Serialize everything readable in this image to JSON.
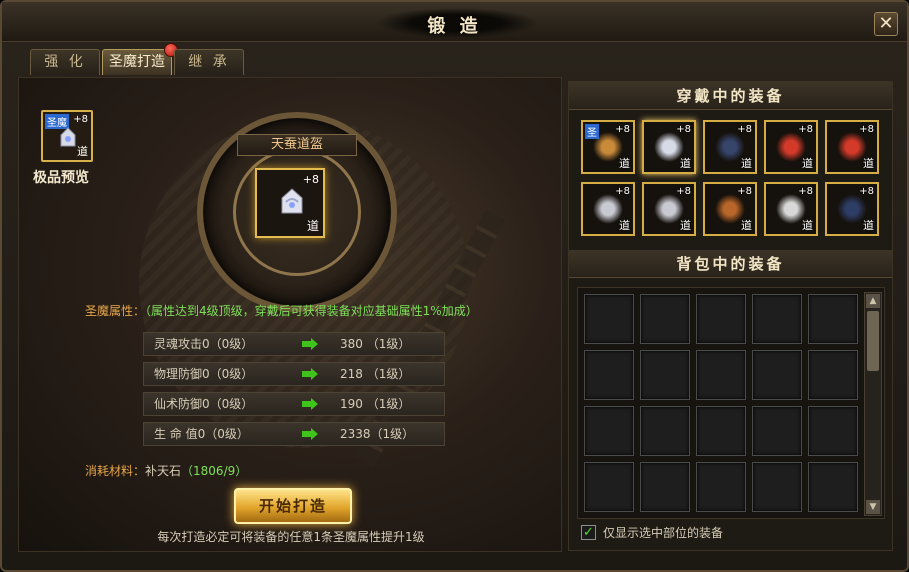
{
  "window": {
    "title": "锻 造",
    "close_glyph": "✕"
  },
  "tabs": [
    {
      "label": "强 化",
      "active": false
    },
    {
      "label": "圣魔打造",
      "active": true,
      "has_alert": true
    },
    {
      "label": "继 承",
      "active": false
    }
  ],
  "preview": {
    "tag": "圣魔",
    "plus": "+8",
    "dao": "道",
    "label": "极品预览"
  },
  "forge_item": {
    "name": "天蚕道盔",
    "plus": "+8",
    "dao": "道"
  },
  "attributes": {
    "title_label": "圣魔属性：",
    "title_note": "（属性达到4级顶级，穿戴后可获得装备对应基础属性1%加成）",
    "rows": [
      {
        "name": "灵魂攻击0（0级）",
        "value": "380 （1级）"
      },
      {
        "name": "物理防御0（0级）",
        "value": "218 （1级）"
      },
      {
        "name": "仙术防御0（0级）",
        "value": "190 （1级）"
      },
      {
        "name": "生 命 值0（0级）",
        "value": "2338（1级）"
      }
    ]
  },
  "cost": {
    "label": "消耗材料：",
    "item": "补天石",
    "amount": "（1806/9）"
  },
  "forge_button": {
    "label": "开始打造"
  },
  "forge_hint": "每次打造必定可将装备的任意1条圣魔属性提升1级",
  "equipped": {
    "title": "穿戴中的装备",
    "items": [
      {
        "icon": "bow-weapon-icon",
        "plus": "+8",
        "dao": "道",
        "tag": "圣",
        "selected": false
      },
      {
        "icon": "helmet-icon",
        "plus": "+8",
        "dao": "道",
        "tag": "",
        "selected": true
      },
      {
        "icon": "robe-armor-icon",
        "plus": "+8",
        "dao": "道",
        "tag": "",
        "selected": false
      },
      {
        "icon": "ring-icon",
        "plus": "+8",
        "dao": "道",
        "tag": "",
        "selected": false
      },
      {
        "icon": "ring-icon",
        "plus": "+8",
        "dao": "道",
        "tag": "",
        "selected": false
      },
      {
        "icon": "bracelet-icon",
        "plus": "+8",
        "dao": "道",
        "tag": "",
        "selected": false
      },
      {
        "icon": "bracelet-icon",
        "plus": "+8",
        "dao": "道",
        "tag": "",
        "selected": false
      },
      {
        "icon": "necklace-icon",
        "plus": "+8",
        "dao": "道",
        "tag": "",
        "selected": false
      },
      {
        "icon": "belt-icon",
        "plus": "+8",
        "dao": "道",
        "tag": "",
        "selected": false
      },
      {
        "icon": "boots-icon",
        "plus": "+8",
        "dao": "道",
        "tag": "",
        "selected": false
      }
    ]
  },
  "bag": {
    "title": "背包中的装备",
    "slot_count": 20
  },
  "filter": {
    "label": "仅显示选中部位的装备",
    "checked": true,
    "check_glyph": "✓"
  },
  "scroll": {
    "up_glyph": "▲",
    "down_glyph": "▼"
  }
}
